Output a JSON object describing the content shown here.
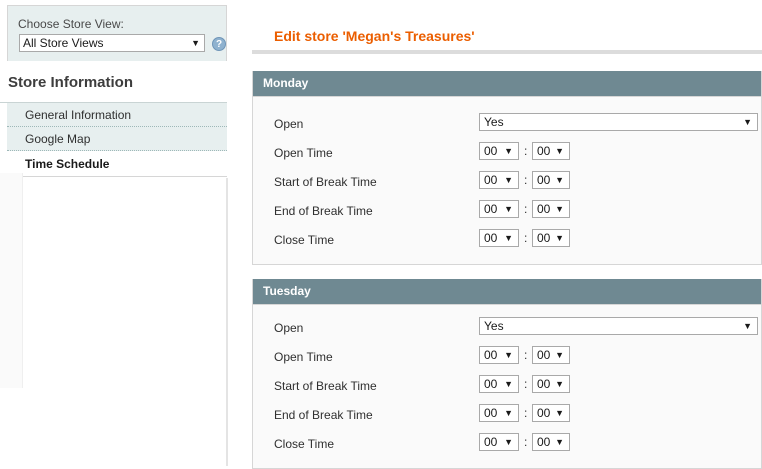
{
  "store_switcher": {
    "label": "Choose Store View:",
    "selected": "All Store Views",
    "help": "?"
  },
  "sidebar": {
    "title": "Store Information",
    "tabs": [
      {
        "label": "General Information",
        "active": false
      },
      {
        "label": "Google Map",
        "active": false
      },
      {
        "label": "Time Schedule",
        "active": true
      }
    ]
  },
  "page": {
    "title": "Edit store 'Megan's Treasures'"
  },
  "days": [
    {
      "name": "Monday",
      "open_label": "Open",
      "open_value": "Yes",
      "rows": [
        {
          "label": "Open Time",
          "hh": "00",
          "mm": "00"
        },
        {
          "label": "Start of Break Time",
          "hh": "00",
          "mm": "00"
        },
        {
          "label": "End of Break Time",
          "hh": "00",
          "mm": "00"
        },
        {
          "label": "Close Time",
          "hh": "00",
          "mm": "00"
        }
      ]
    },
    {
      "name": "Tuesday",
      "open_label": "Open",
      "open_value": "Yes",
      "rows": [
        {
          "label": "Open Time",
          "hh": "00",
          "mm": "00"
        },
        {
          "label": "Start of Break Time",
          "hh": "00",
          "mm": "00"
        },
        {
          "label": "End of Break Time",
          "hh": "00",
          "mm": "00"
        },
        {
          "label": "Close Time",
          "hh": "00",
          "mm": "00"
        }
      ]
    }
  ],
  "time_separator": ":",
  "colors": {
    "accent": "#eb5e00",
    "section_header": "#6f8992",
    "tab_bg": "#e7efef"
  }
}
